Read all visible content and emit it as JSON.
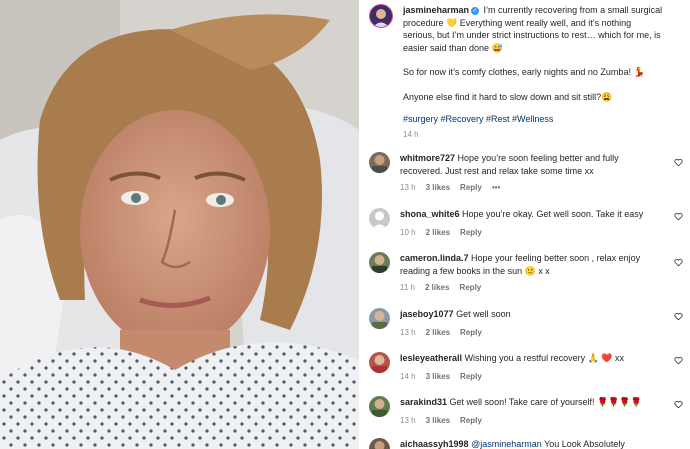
{
  "caption": {
    "username": "jasmineharman",
    "verified_icon": "verified-badge-icon",
    "line1": "I’m currently recovering from a small surgical procedure 💛 Everything went really well, and it’s nothing serious, but I’m under strict instructions to rest… which for me, is easier said than done 😅",
    "line2": "So for now it’s comfy clothes, early nights and no Zumba! 💃",
    "line3": "Anyone else find it hard to slow down and sit still?😩",
    "hashtags": "#surgery #Recovery #Rest #Wellness",
    "time": "14 h"
  },
  "comments": [
    {
      "username": "whitmore727",
      "text": "Hope you’re soon feeling better and fully recovered. Just rest and relax take some time xx",
      "time": "13 h",
      "likes": "3 likes",
      "reply": "Reply",
      "more": "•••"
    },
    {
      "username": "shona_white6",
      "text": "Hope you’re okay. Get well soon. Take it easy",
      "time": "10 h",
      "likes": "2 likes",
      "reply": "Reply"
    },
    {
      "username": "cameron.linda.7",
      "text": "Hope your feeling better soon , relax enjoy reading a few books in the sun 🙂 x x",
      "time": "11 h",
      "likes": "2 likes",
      "reply": "Reply"
    },
    {
      "username": "jaseboy1077",
      "text": "Get well soon",
      "time": "13 h",
      "likes": "2 likes",
      "reply": "Reply"
    },
    {
      "username": "lesleyeatherall",
      "text": "Wishing you a restful recovery 🙏 ❤️ xx",
      "time": "14 h",
      "likes": "3 likes",
      "reply": "Reply"
    },
    {
      "username": "sarakind31",
      "text": "Get well soon! Take care of yourself! 🌹🌹🌹🌹",
      "time": "13 h",
      "likes": "3 likes",
      "reply": "Reply"
    },
    {
      "username": "aichaassyh1998",
      "mention": "@jasmineharman",
      "text": "You Look Absolutely"
    }
  ]
}
